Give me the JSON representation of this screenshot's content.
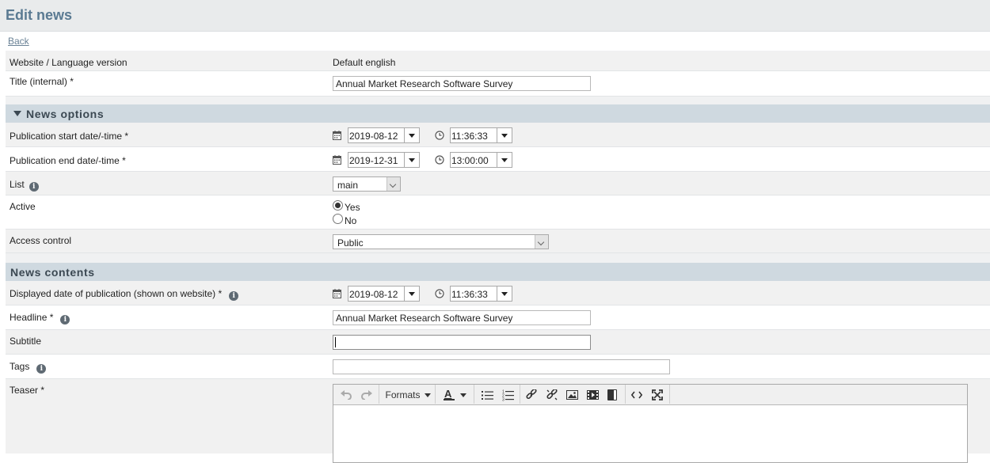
{
  "page": {
    "title": "Edit news",
    "back_label": "Back"
  },
  "general": {
    "language_label": "Website / Language version",
    "language_value": "Default english",
    "title_label": "Title (internal) *",
    "title_value": "Annual Market Research Software Survey"
  },
  "news_options": {
    "heading": "News options",
    "start_label": "Publication start date/-time *",
    "start_date": "2019-08-12",
    "start_time": "11:36:33",
    "end_label": "Publication end date/-time *",
    "end_date": "2019-12-31",
    "end_time": "13:00:00",
    "list_label": "List",
    "list_value": "main",
    "active_label": "Active",
    "active_yes": "Yes",
    "active_no": "No",
    "active_selected": "Yes",
    "access_label": "Access control",
    "access_value": "Public"
  },
  "news_contents": {
    "heading": "News contents",
    "display_date_label": "Displayed date of publication (shown on website) *",
    "display_date": "2019-08-12",
    "display_time": "11:36:33",
    "headline_label": "Headline *",
    "headline_value": "Annual Market Research Software Survey",
    "subtitle_label": "Subtitle",
    "subtitle_value": "",
    "tags_label": "Tags",
    "tags_value": "",
    "teaser_label": "Teaser *",
    "editor_formats_label": "Formats"
  },
  "icons": {
    "info": "info-icon",
    "calendar": "calendar-icon",
    "clock": "clock-icon",
    "undo": "undo-icon",
    "redo": "redo-icon",
    "text_color": "text-color-icon",
    "bullet_list": "bullet-list-icon",
    "numbered_list": "numbered-list-icon",
    "link": "link-icon",
    "unlink": "unlink-icon",
    "image": "image-icon",
    "media": "media-icon",
    "template": "template-icon",
    "code": "code-icon",
    "fullscreen": "fullscreen-icon"
  },
  "colors": {
    "title": "#5a7a92",
    "section_bg": "#cfd9e0",
    "row_alt": "#f1f1f1"
  }
}
